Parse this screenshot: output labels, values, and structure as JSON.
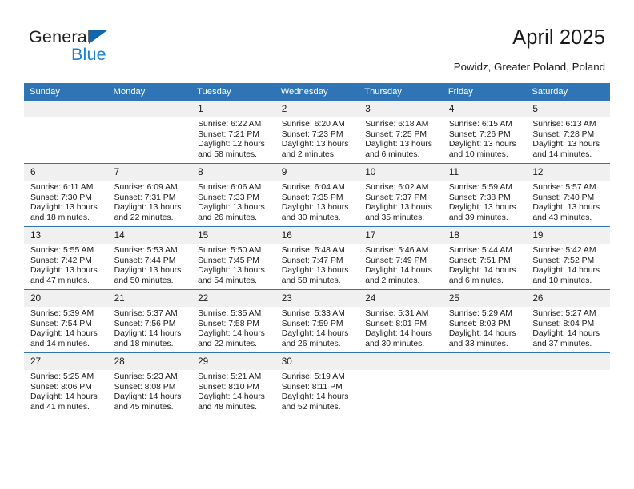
{
  "brand": {
    "name_part1": "General",
    "name_part2": "Blue",
    "accent_color": "#1b7fd4",
    "logo_triangle_color": "#1266b0"
  },
  "header": {
    "title": "April 2025",
    "subtitle": "Powidz, Greater Poland, Poland"
  },
  "calendar": {
    "header_background": "#2f75b5",
    "daynum_background": "#f0f0f0",
    "weekday_headers": [
      "Sunday",
      "Monday",
      "Tuesday",
      "Wednesday",
      "Thursday",
      "Friday",
      "Saturday"
    ],
    "weeks": [
      [
        {
          "day": "",
          "sunrise": "",
          "sunset": "",
          "daylight": ""
        },
        {
          "day": "",
          "sunrise": "",
          "sunset": "",
          "daylight": ""
        },
        {
          "day": "1",
          "sunrise": "Sunrise: 6:22 AM",
          "sunset": "Sunset: 7:21 PM",
          "daylight": "Daylight: 12 hours and 58 minutes."
        },
        {
          "day": "2",
          "sunrise": "Sunrise: 6:20 AM",
          "sunset": "Sunset: 7:23 PM",
          "daylight": "Daylight: 13 hours and 2 minutes."
        },
        {
          "day": "3",
          "sunrise": "Sunrise: 6:18 AM",
          "sunset": "Sunset: 7:25 PM",
          "daylight": "Daylight: 13 hours and 6 minutes."
        },
        {
          "day": "4",
          "sunrise": "Sunrise: 6:15 AM",
          "sunset": "Sunset: 7:26 PM",
          "daylight": "Daylight: 13 hours and 10 minutes."
        },
        {
          "day": "5",
          "sunrise": "Sunrise: 6:13 AM",
          "sunset": "Sunset: 7:28 PM",
          "daylight": "Daylight: 13 hours and 14 minutes."
        }
      ],
      [
        {
          "day": "6",
          "sunrise": "Sunrise: 6:11 AM",
          "sunset": "Sunset: 7:30 PM",
          "daylight": "Daylight: 13 hours and 18 minutes."
        },
        {
          "day": "7",
          "sunrise": "Sunrise: 6:09 AM",
          "sunset": "Sunset: 7:31 PM",
          "daylight": "Daylight: 13 hours and 22 minutes."
        },
        {
          "day": "8",
          "sunrise": "Sunrise: 6:06 AM",
          "sunset": "Sunset: 7:33 PM",
          "daylight": "Daylight: 13 hours and 26 minutes."
        },
        {
          "day": "9",
          "sunrise": "Sunrise: 6:04 AM",
          "sunset": "Sunset: 7:35 PM",
          "daylight": "Daylight: 13 hours and 30 minutes."
        },
        {
          "day": "10",
          "sunrise": "Sunrise: 6:02 AM",
          "sunset": "Sunset: 7:37 PM",
          "daylight": "Daylight: 13 hours and 35 minutes."
        },
        {
          "day": "11",
          "sunrise": "Sunrise: 5:59 AM",
          "sunset": "Sunset: 7:38 PM",
          "daylight": "Daylight: 13 hours and 39 minutes."
        },
        {
          "day": "12",
          "sunrise": "Sunrise: 5:57 AM",
          "sunset": "Sunset: 7:40 PM",
          "daylight": "Daylight: 13 hours and 43 minutes."
        }
      ],
      [
        {
          "day": "13",
          "sunrise": "Sunrise: 5:55 AM",
          "sunset": "Sunset: 7:42 PM",
          "daylight": "Daylight: 13 hours and 47 minutes."
        },
        {
          "day": "14",
          "sunrise": "Sunrise: 5:53 AM",
          "sunset": "Sunset: 7:44 PM",
          "daylight": "Daylight: 13 hours and 50 minutes."
        },
        {
          "day": "15",
          "sunrise": "Sunrise: 5:50 AM",
          "sunset": "Sunset: 7:45 PM",
          "daylight": "Daylight: 13 hours and 54 minutes."
        },
        {
          "day": "16",
          "sunrise": "Sunrise: 5:48 AM",
          "sunset": "Sunset: 7:47 PM",
          "daylight": "Daylight: 13 hours and 58 minutes."
        },
        {
          "day": "17",
          "sunrise": "Sunrise: 5:46 AM",
          "sunset": "Sunset: 7:49 PM",
          "daylight": "Daylight: 14 hours and 2 minutes."
        },
        {
          "day": "18",
          "sunrise": "Sunrise: 5:44 AM",
          "sunset": "Sunset: 7:51 PM",
          "daylight": "Daylight: 14 hours and 6 minutes."
        },
        {
          "day": "19",
          "sunrise": "Sunrise: 5:42 AM",
          "sunset": "Sunset: 7:52 PM",
          "daylight": "Daylight: 14 hours and 10 minutes."
        }
      ],
      [
        {
          "day": "20",
          "sunrise": "Sunrise: 5:39 AM",
          "sunset": "Sunset: 7:54 PM",
          "daylight": "Daylight: 14 hours and 14 minutes."
        },
        {
          "day": "21",
          "sunrise": "Sunrise: 5:37 AM",
          "sunset": "Sunset: 7:56 PM",
          "daylight": "Daylight: 14 hours and 18 minutes."
        },
        {
          "day": "22",
          "sunrise": "Sunrise: 5:35 AM",
          "sunset": "Sunset: 7:58 PM",
          "daylight": "Daylight: 14 hours and 22 minutes."
        },
        {
          "day": "23",
          "sunrise": "Sunrise: 5:33 AM",
          "sunset": "Sunset: 7:59 PM",
          "daylight": "Daylight: 14 hours and 26 minutes."
        },
        {
          "day": "24",
          "sunrise": "Sunrise: 5:31 AM",
          "sunset": "Sunset: 8:01 PM",
          "daylight": "Daylight: 14 hours and 30 minutes."
        },
        {
          "day": "25",
          "sunrise": "Sunrise: 5:29 AM",
          "sunset": "Sunset: 8:03 PM",
          "daylight": "Daylight: 14 hours and 33 minutes."
        },
        {
          "day": "26",
          "sunrise": "Sunrise: 5:27 AM",
          "sunset": "Sunset: 8:04 PM",
          "daylight": "Daylight: 14 hours and 37 minutes."
        }
      ],
      [
        {
          "day": "27",
          "sunrise": "Sunrise: 5:25 AM",
          "sunset": "Sunset: 8:06 PM",
          "daylight": "Daylight: 14 hours and 41 minutes."
        },
        {
          "day": "28",
          "sunrise": "Sunrise: 5:23 AM",
          "sunset": "Sunset: 8:08 PM",
          "daylight": "Daylight: 14 hours and 45 minutes."
        },
        {
          "day": "29",
          "sunrise": "Sunrise: 5:21 AM",
          "sunset": "Sunset: 8:10 PM",
          "daylight": "Daylight: 14 hours and 48 minutes."
        },
        {
          "day": "30",
          "sunrise": "Sunrise: 5:19 AM",
          "sunset": "Sunset: 8:11 PM",
          "daylight": "Daylight: 14 hours and 52 minutes."
        },
        {
          "day": "",
          "sunrise": "",
          "sunset": "",
          "daylight": ""
        },
        {
          "day": "",
          "sunrise": "",
          "sunset": "",
          "daylight": ""
        },
        {
          "day": "",
          "sunrise": "",
          "sunset": "",
          "daylight": ""
        }
      ]
    ]
  }
}
